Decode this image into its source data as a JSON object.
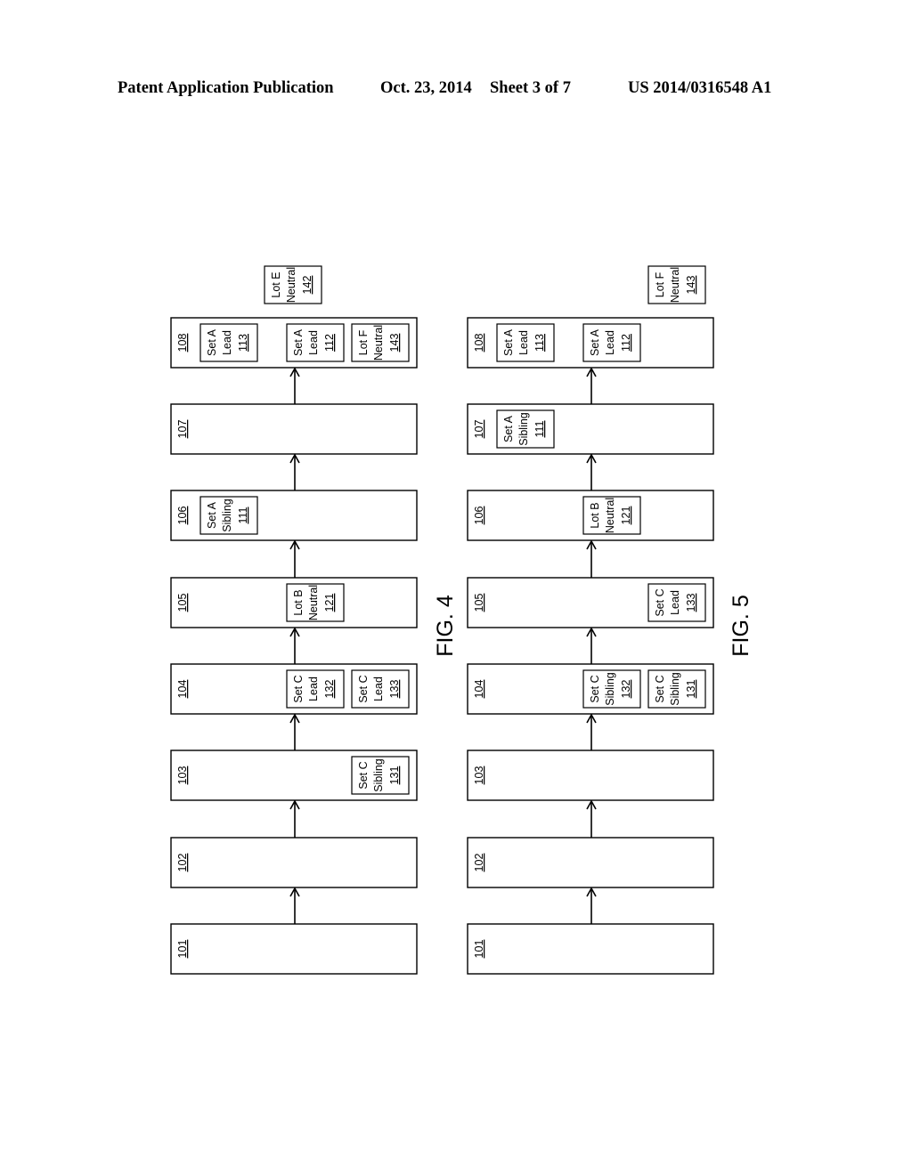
{
  "header": {
    "publication": "Patent Application Publication",
    "date": "Oct. 23, 2014",
    "sheet": "Sheet 3 of 7",
    "number": "US 2014/0316548 A1"
  },
  "figures": [
    {
      "label": "FIG. 4",
      "outside_items": [
        {
          "line1": "Lot E",
          "line2": "Neutral",
          "ref": "142",
          "near_stage": "108",
          "slot": 2
        }
      ],
      "stages": [
        {
          "ref": "101",
          "items": []
        },
        {
          "ref": "102",
          "items": []
        },
        {
          "ref": "103",
          "items": [
            {
              "line1": "Set C",
              "line2": "Sibling",
              "ref": "131",
              "slot": 3
            }
          ]
        },
        {
          "ref": "104",
          "items": [
            {
              "line1": "Set C",
              "line2": "Lead",
              "ref": "132",
              "slot": 2
            },
            {
              "line1": "Set C",
              "line2": "Lead",
              "ref": "133",
              "slot": 3
            }
          ]
        },
        {
          "ref": "105",
          "items": [
            {
              "line1": "Lot B",
              "line2": "Neutral",
              "ref": "121",
              "slot": 2
            }
          ]
        },
        {
          "ref": "106",
          "items": [
            {
              "line1": "Set A",
              "line2": "Sibling",
              "ref": "111",
              "slot": 1
            }
          ]
        },
        {
          "ref": "107",
          "items": []
        },
        {
          "ref": "108",
          "items": [
            {
              "line1": "Set A",
              "line2": "Lead",
              "ref": "113",
              "slot": 1
            },
            {
              "line1": "Set A",
              "line2": "Lead",
              "ref": "112",
              "slot": 2
            },
            {
              "line1": "Lot F",
              "line2": "Neutral",
              "ref": "143",
              "slot": 3
            }
          ]
        }
      ]
    },
    {
      "label": "FIG. 5",
      "outside_items": [
        {
          "line1": "Lot F",
          "line2": "Neutral",
          "ref": "143",
          "near_stage": "108",
          "slot": 3
        }
      ],
      "stages": [
        {
          "ref": "101",
          "items": []
        },
        {
          "ref": "102",
          "items": []
        },
        {
          "ref": "103",
          "items": []
        },
        {
          "ref": "104",
          "items": [
            {
              "line1": "Set C",
              "line2": "Sibling",
              "ref": "132",
              "slot": 2
            },
            {
              "line1": "Set C",
              "line2": "Sibling",
              "ref": "131",
              "slot": 3
            }
          ]
        },
        {
          "ref": "105",
          "items": [
            {
              "line1": "Set C",
              "line2": "Lead",
              "ref": "133",
              "slot": 3
            }
          ]
        },
        {
          "ref": "106",
          "items": [
            {
              "line1": "Lot B",
              "line2": "Neutral",
              "ref": "121",
              "slot": 2
            }
          ]
        },
        {
          "ref": "107",
          "items": [
            {
              "line1": "Set A",
              "line2": "Sibling",
              "ref": "111",
              "slot": 1
            }
          ]
        },
        {
          "ref": "108",
          "items": [
            {
              "line1": "Set A",
              "line2": "Lead",
              "ref": "113",
              "slot": 1
            },
            {
              "line1": "Set A",
              "line2": "Lead",
              "ref": "112",
              "slot": 2
            }
          ]
        }
      ]
    }
  ]
}
